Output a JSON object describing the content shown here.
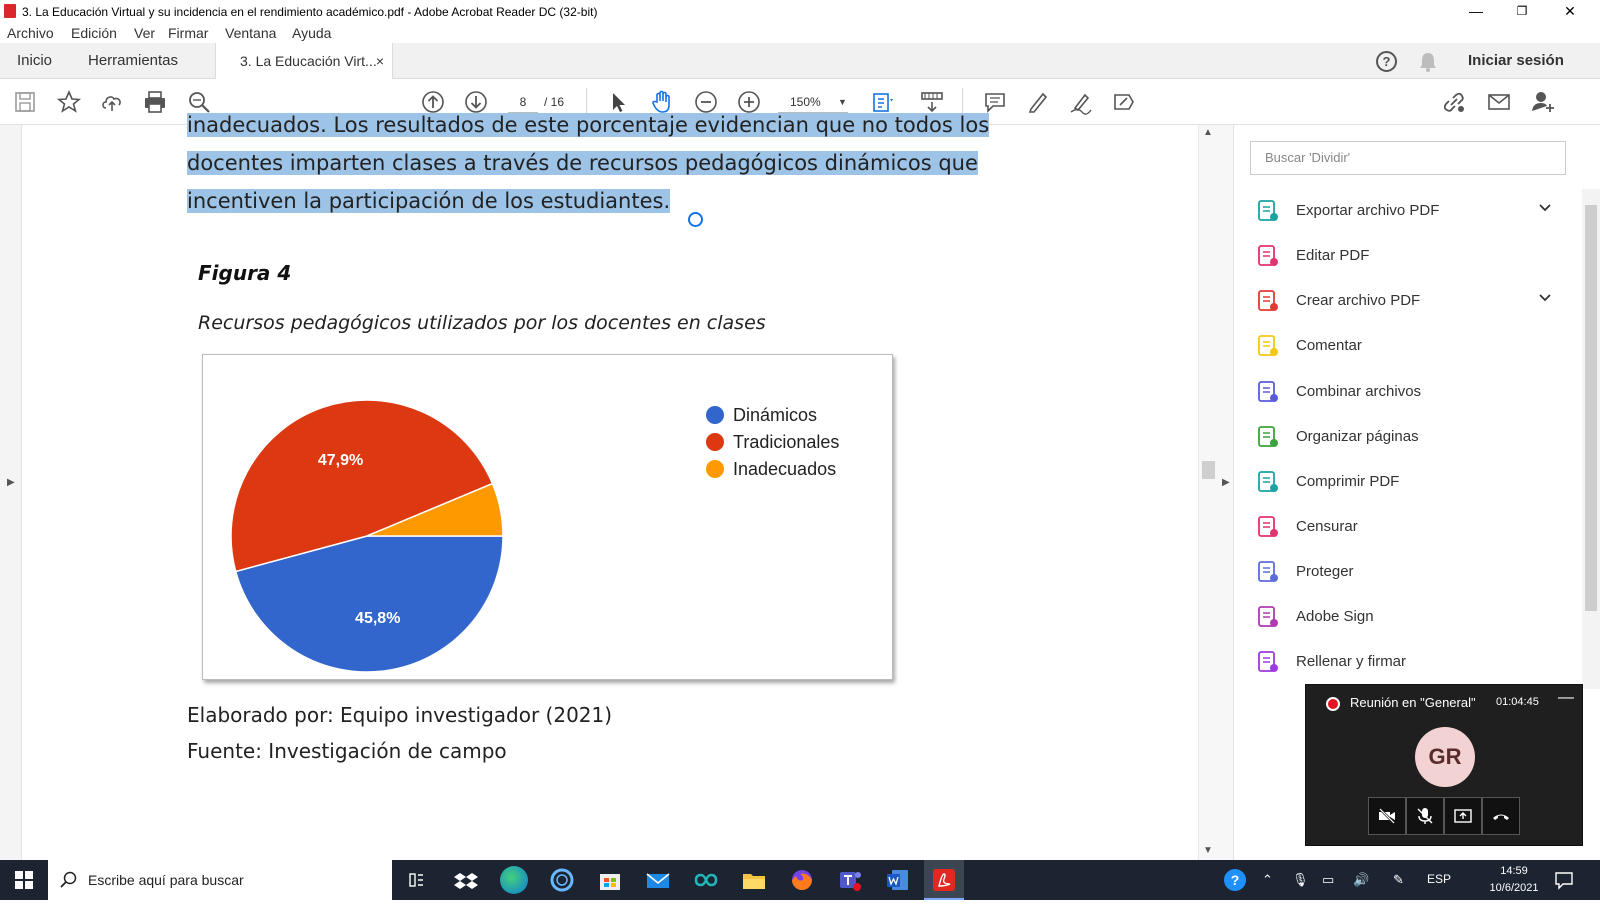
{
  "window": {
    "title": "3. La Educación Virtual y su incidencia en el rendimiento académico.pdf - Adobe Acrobat Reader DC (32-bit)",
    "minimize": "—",
    "maximize": "❐",
    "close": "✕"
  },
  "menu": [
    "Archivo",
    "Edición",
    "Ver",
    "Firmar",
    "Ventana",
    "Ayuda"
  ],
  "tabs": {
    "home": "Inicio",
    "tools": "Herramientas",
    "doc": "3. La Educación Virt...",
    "close": "×",
    "sign_in": "Iniciar sesión"
  },
  "toolbar": {
    "page_current": "8",
    "page_total": "/ 16",
    "zoom": "150%"
  },
  "document": {
    "line1": "inadecuados. Los resultados de este porcentaje evidencian que no todos los",
    "line2": "docentes imparten clases a través de recursos pedagógicos dinámicos que",
    "line3": "incentiven la participación de los estudiantes.",
    "figure_title": "Figura 4",
    "figure_caption": "Recursos pedagógicos utilizados por los docentes en clases",
    "footer1": "Elaborado por: Equipo investigador (2021)",
    "footer2": "Fuente: Investigación de campo"
  },
  "chart_data": {
    "type": "pie",
    "title": "",
    "categories": [
      "Dinámicos",
      "Tradicionales",
      "Inadecuados"
    ],
    "values": [
      45.8,
      47.9,
      6.3
    ],
    "labels": [
      "45,8%",
      "47,9%",
      ""
    ],
    "colors": [
      "#3366cc",
      "#dc3912",
      "#ff9900"
    ],
    "legend": "right"
  },
  "right_panel": {
    "search_placeholder": "Buscar 'Dividir'",
    "tools": [
      {
        "label": "Exportar archivo PDF",
        "icon": "export-pdf-icon",
        "color": "#19a3a3",
        "chevron": "⌄"
      },
      {
        "label": "Editar PDF",
        "icon": "edit-pdf-icon",
        "color": "#e4326f",
        "chevron": ""
      },
      {
        "label": "Crear archivo PDF",
        "icon": "create-pdf-icon",
        "color": "#e53935",
        "chevron": "⌄"
      },
      {
        "label": "Comentar",
        "icon": "comment-icon",
        "color": "#f2c811",
        "chevron": ""
      },
      {
        "label": "Combinar archivos",
        "icon": "combine-icon",
        "color": "#5b5bdc",
        "chevron": ""
      },
      {
        "label": "Organizar páginas",
        "icon": "organize-icon",
        "color": "#3ba33b",
        "chevron": ""
      },
      {
        "label": "Comprimir PDF",
        "icon": "compress-icon",
        "color": "#19a3a3",
        "chevron": ""
      },
      {
        "label": "Censurar",
        "icon": "redact-icon",
        "color": "#e4326f",
        "chevron": ""
      },
      {
        "label": "Proteger",
        "icon": "protect-icon",
        "color": "#5b6cdc",
        "chevron": ""
      },
      {
        "label": "Adobe Sign",
        "icon": "adobe-sign-icon",
        "color": "#b03ab0",
        "chevron": ""
      },
      {
        "label": "Rellenar y firmar",
        "icon": "fill-sign-icon",
        "color": "#9b3ae0",
        "chevron": ""
      }
    ]
  },
  "meeting": {
    "title": "Reunión en \"General\"",
    "time": "01:04:45",
    "minimize": "—",
    "avatar": "GR"
  },
  "taskbar": {
    "search_placeholder": "Escribe aquí para buscar",
    "lang": "ESP",
    "time": "14:59",
    "date": "10/6/2021"
  }
}
